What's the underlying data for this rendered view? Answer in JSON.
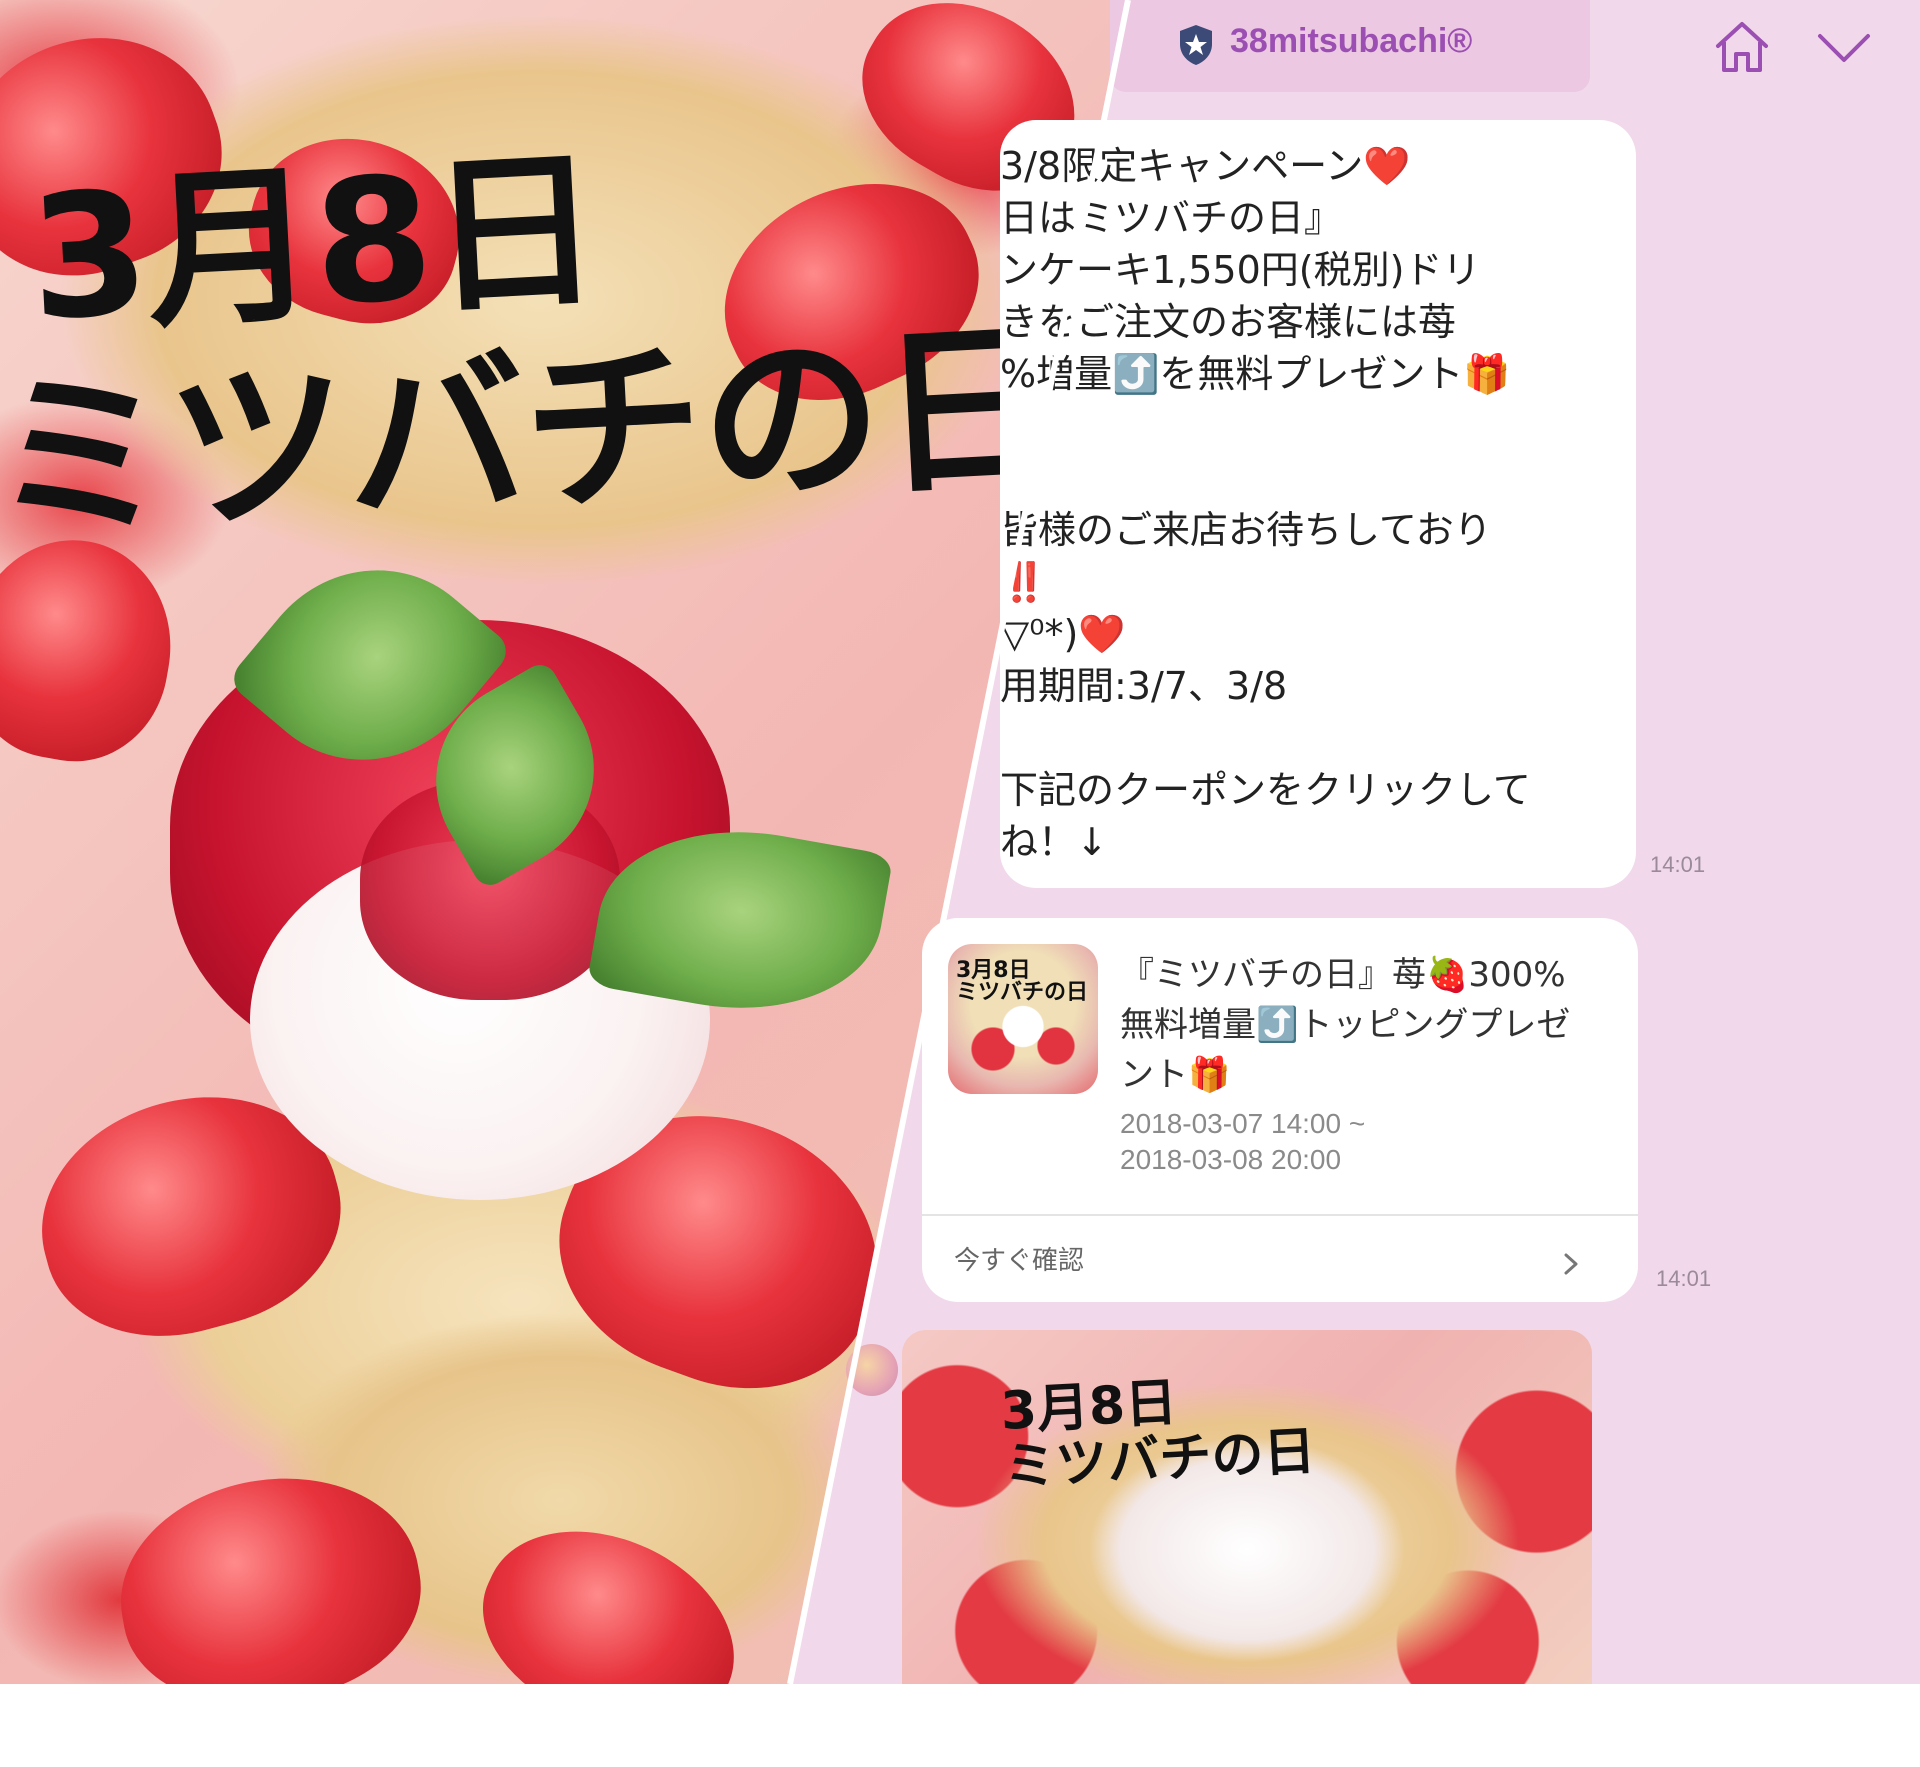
{
  "promo_photo": {
    "title_line1": "3月8日",
    "title_line2": "ミツバチの日"
  },
  "chat": {
    "header": {
      "account_name": "38mitsubachi®",
      "icons": [
        "shield-icon",
        "home-icon",
        "chevron-down-icon"
      ]
    },
    "message1": {
      "text": "3/8限定キャンペーン❤️\n日はミツバチの日』\nンケーキ1,550円(税別)ドリ\nきをご注文のお客様には苺\n%増量⤴️を無料プレゼント🎁\n\n\n皆様のご来店お待ちしており\n‼️\n▽⁰*)❤️\n用期間:3/7、3/8\n\n下記のクーポンをクリックして\nね！↓",
      "time": "14:01"
    },
    "message2": {
      "thumb_text": "3月8日\nミツバチの日",
      "title": "『ミツバチの日』苺🍓300%\n無料増量⤴️トッピングプレゼ\nント🎁",
      "period": "2018-03-07 14:00 ~\n2018-03-08 20:00",
      "confirm_label": "今すぐ確認",
      "time": "14:01"
    },
    "message3": {
      "image_title": "3月8日\nミツバチの日"
    }
  },
  "colors": {
    "chat_background": "#f1d8ea",
    "header_background": "#ecc8e2",
    "account_name": "#9b4fb2",
    "bubble": "#ffffff"
  }
}
